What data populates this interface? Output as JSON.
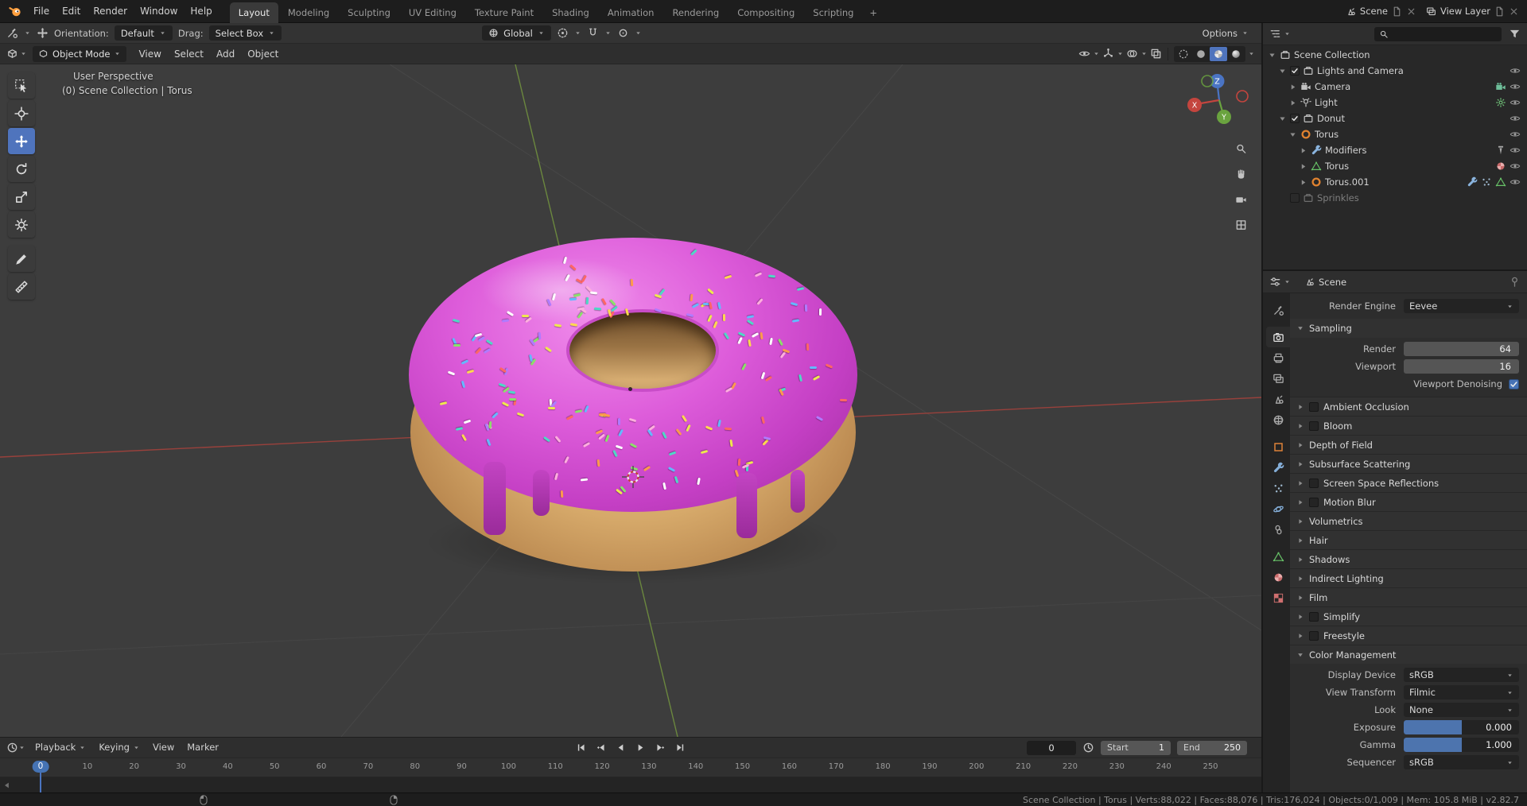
{
  "colors": {
    "accent": "#4772b3",
    "glaze": "#c43fc4",
    "dough": "#d6a96a"
  },
  "topbar": {
    "menus": [
      "File",
      "Edit",
      "Render",
      "Window",
      "Help"
    ],
    "workspaces": [
      "Layout",
      "Modeling",
      "Sculpting",
      "UV Editing",
      "Texture Paint",
      "Shading",
      "Animation",
      "Rendering",
      "Compositing",
      "Scripting"
    ],
    "active_workspace": "Layout",
    "add_workspace_label": "+",
    "scene_label": "Scene",
    "view_layer_label": "View Layer"
  },
  "tool_settings": {
    "orientation_label": "Orientation:",
    "orientation_value": "Default",
    "drag_label": "Drag:",
    "drag_value": "Select Box",
    "transform_orientation": "Global",
    "options_label": "Options"
  },
  "viewport": {
    "mode": "Object Mode",
    "menus": [
      "View",
      "Select",
      "Add",
      "Object"
    ],
    "overlay_line1": "User Perspective",
    "overlay_line2": "(0) Scene Collection | Torus",
    "toolbar": [
      {
        "name": "select-box",
        "active": false
      },
      {
        "name": "cursor",
        "active": false
      },
      {
        "name": "move",
        "active": true
      },
      {
        "name": "rotate",
        "active": false
      },
      {
        "name": "scale",
        "active": false
      },
      {
        "name": "transform",
        "active": false
      },
      {
        "name": "annotate",
        "active": false,
        "gap_before": true
      },
      {
        "name": "measure",
        "active": false
      }
    ],
    "axis_labels": {
      "x": "X",
      "y": "Y",
      "z": "Z"
    },
    "shading_modes": [
      "wireframe",
      "solid",
      "material",
      "rendered"
    ],
    "active_shading": "material",
    "sprinkle_colors": [
      "#ffffff",
      "#ffd94f",
      "#8be06a",
      "#64b9ff",
      "#ff9a4d",
      "#ff6666",
      "#4fd8c6",
      "#ffaede",
      "#efe84e",
      "#b07bff"
    ]
  },
  "outliner": {
    "rows": [
      {
        "label": "Scene Collection",
        "icon": "collection",
        "indent": 0,
        "expand": "down"
      },
      {
        "label": "Lights and Camera",
        "icon": "collection",
        "indent": 1,
        "expand": "down",
        "checkbox": "checked",
        "eye": true
      },
      {
        "label": "Camera",
        "icon": "camera",
        "indent": 2,
        "expand": "right",
        "trailing": [
          "camera-data"
        ],
        "eye": true
      },
      {
        "label": "Light",
        "icon": "light",
        "indent": 2,
        "expand": "right",
        "trailing": [
          "light-data"
        ],
        "eye": true
      },
      {
        "label": "Donut",
        "icon": "collection",
        "indent": 1,
        "expand": "down",
        "checkbox": "checked",
        "eye": true
      },
      {
        "label": "Torus",
        "icon": "object",
        "indent": 2,
        "expand": "down",
        "eye": true
      },
      {
        "label": "Modifiers",
        "icon": "modifier",
        "indent": 3,
        "expand": "right",
        "trailing": [
          "screw"
        ],
        "eye": true
      },
      {
        "label": "Torus",
        "icon": "mesh",
        "indent": 3,
        "expand": "right",
        "trailing": [
          "material"
        ],
        "eye": true
      },
      {
        "label": "Torus.001",
        "icon": "object",
        "indent": 3,
        "expand": "right",
        "trailing": [
          "modifier",
          "particles",
          "mesh"
        ],
        "eye": true
      },
      {
        "label": "Sprinkles",
        "icon": "collection",
        "indent": 1,
        "checkbox": "unchecked",
        "grayed": true
      }
    ]
  },
  "properties": {
    "tabs": [
      {
        "name": "tool"
      },
      {
        "name": "render",
        "active": true,
        "group_start": true
      },
      {
        "name": "output"
      },
      {
        "name": "view-layer"
      },
      {
        "name": "scene"
      },
      {
        "name": "world"
      },
      {
        "name": "object",
        "group_start": true
      },
      {
        "name": "modifiers"
      },
      {
        "name": "particles"
      },
      {
        "name": "physics"
      },
      {
        "name": "constraints"
      },
      {
        "name": "mesh-data",
        "group_start": true
      },
      {
        "name": "material"
      },
      {
        "name": "texture"
      }
    ],
    "breadcrumb": "Scene",
    "render_engine_label": "Render Engine",
    "render_engine_value": "Eevee",
    "sections": [
      {
        "label": "Sampling",
        "expanded": true,
        "rows": [
          {
            "type": "number",
            "label": "Render",
            "value": "64"
          },
          {
            "type": "number",
            "label": "Viewport",
            "value": "16"
          },
          {
            "type": "check",
            "label": "Viewport Denoising",
            "checked": true
          }
        ]
      },
      {
        "label": "Ambient Occlusion",
        "has_checkbox": true
      },
      {
        "label": "Bloom",
        "has_checkbox": true
      },
      {
        "label": "Depth of Field"
      },
      {
        "label": "Subsurface Scattering"
      },
      {
        "label": "Screen Space Reflections",
        "has_checkbox": true
      },
      {
        "label": "Motion Blur",
        "has_checkbox": true
      },
      {
        "label": "Volumetrics"
      },
      {
        "label": "Hair"
      },
      {
        "label": "Shadows"
      },
      {
        "label": "Indirect Lighting"
      },
      {
        "label": "Film"
      },
      {
        "label": "Simplify",
        "has_checkbox": true
      },
      {
        "label": "Freestyle",
        "has_checkbox": true
      },
      {
        "label": "Color Management",
        "expanded": true,
        "rows": [
          {
            "type": "select",
            "label": "Display Device",
            "value": "sRGB"
          },
          {
            "type": "select",
            "label": "View Transform",
            "value": "Filmic"
          },
          {
            "type": "select",
            "label": "Look",
            "value": "None"
          },
          {
            "type": "slider",
            "label": "Exposure",
            "value": "0.000",
            "fill": 0.5
          },
          {
            "type": "slider",
            "label": "Gamma",
            "value": "1.000",
            "fill": 0.5
          },
          {
            "type": "select",
            "label": "Sequencer",
            "value": "sRGB"
          }
        ]
      }
    ]
  },
  "timeline": {
    "menus": [
      {
        "label": "Playback",
        "caret": true
      },
      {
        "label": "Keying",
        "caret": true
      },
      {
        "label": "View",
        "caret": false
      },
      {
        "label": "Marker",
        "caret": false
      }
    ],
    "playback_buttons": [
      "jump-start",
      "prev-keyframe",
      "play-reverse",
      "play",
      "next-keyframe",
      "jump-end"
    ],
    "current_frame": "0",
    "start_label": "Start",
    "start_value": "1",
    "end_label": "End",
    "end_value": "250",
    "ruler": {
      "min": 0,
      "max": 250,
      "step": 10
    }
  },
  "statusbar": {
    "stats": "Scene Collection | Torus | Verts:88,022 | Faces:88,076 | Tris:176,024 | Objects:0/1,009 | Mem: 105.8 MiB | v2.82.7"
  }
}
